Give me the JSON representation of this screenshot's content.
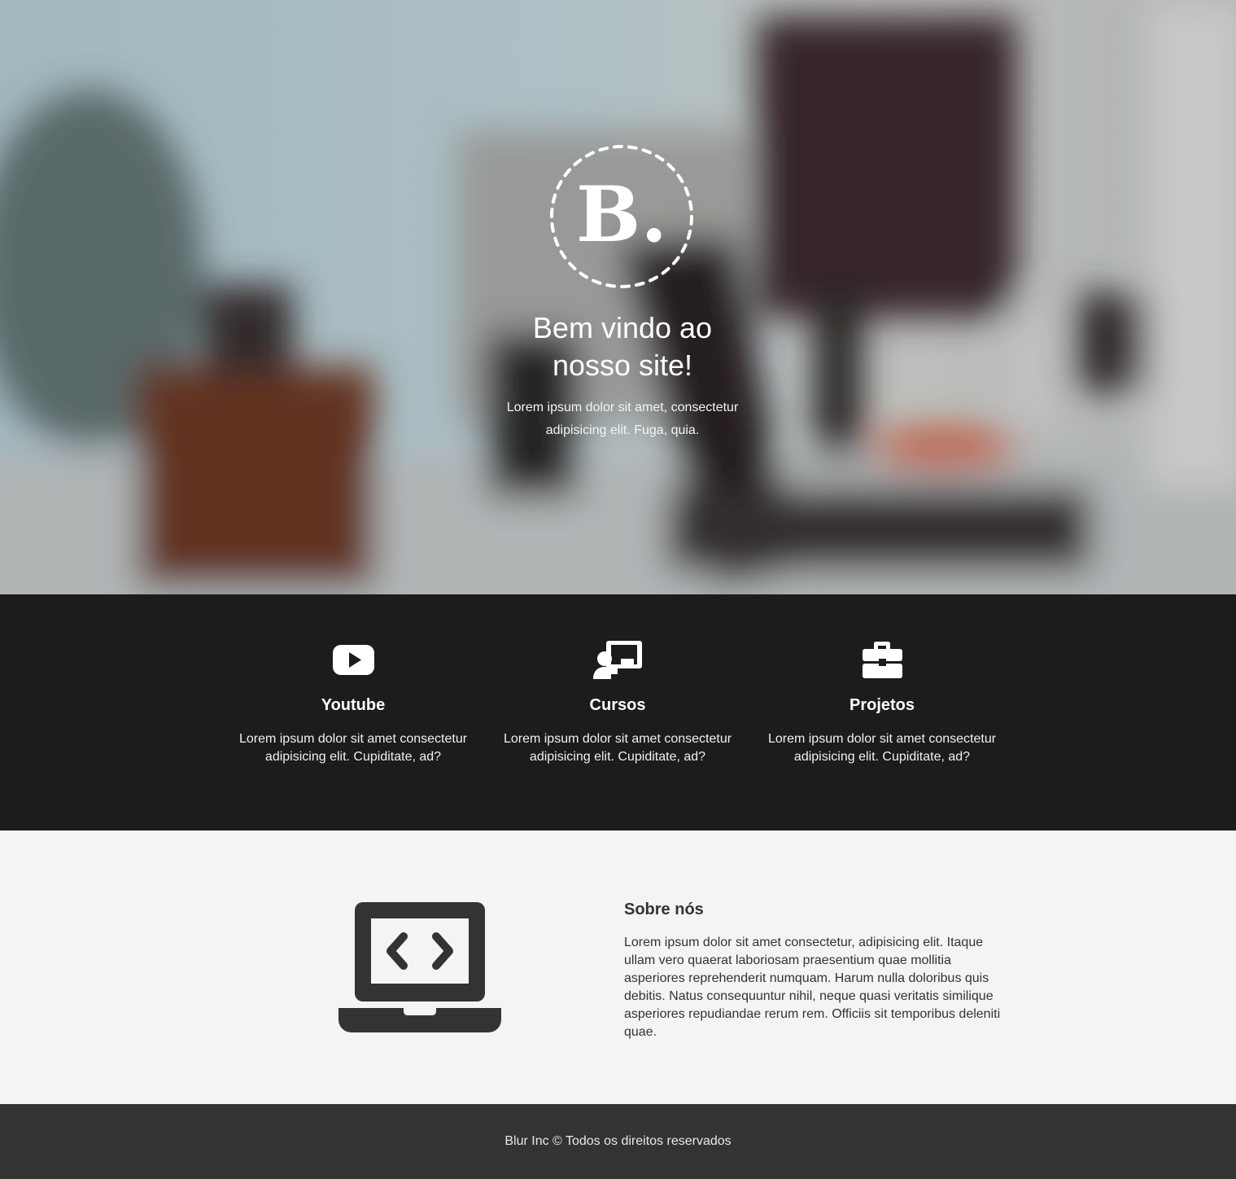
{
  "hero": {
    "logo_letter": "B.",
    "title_line1": "Bem vindo ao",
    "title_line2": "nosso site!",
    "subtitle": "Lorem ipsum dolor sit amet, consectetur adipisicing elit. Fuga, quia."
  },
  "services": [
    {
      "icon": "youtube-icon",
      "title": "Youtube",
      "text": "Lorem ipsum dolor sit amet consectetur adipisicing elit. Cupiditate, ad?"
    },
    {
      "icon": "teacher-icon",
      "title": "Cursos",
      "text": "Lorem ipsum dolor sit amet consectetur adipisicing elit. Cupiditate, ad?"
    },
    {
      "icon": "briefcase-icon",
      "title": "Projetos",
      "text": "Lorem ipsum dolor sit amet consectetur adipisicing elit. Cupiditate, ad?"
    }
  ],
  "about": {
    "icon": "laptop-code-icon",
    "title": "Sobre nós",
    "text": "Lorem ipsum dolor sit amet consectetur, adipisicing elit. Itaque ullam vero quaerat laboriosam praesentium quae mollitia asperiores reprehenderit numquam. Harum nulla doloribus quis debitis. Natus consequuntur nihil, neque quasi veritatis similique asperiores repudiandae rerum rem. Officiis sit temporibus deleniti quae."
  },
  "footer": {
    "text": "Blur Inc © Todos os direitos reservados"
  },
  "colors": {
    "services_bg": "#1c1c1c",
    "about_bg": "#f4f4f4",
    "footer_bg": "#333333",
    "icon_dark": "#333333"
  }
}
